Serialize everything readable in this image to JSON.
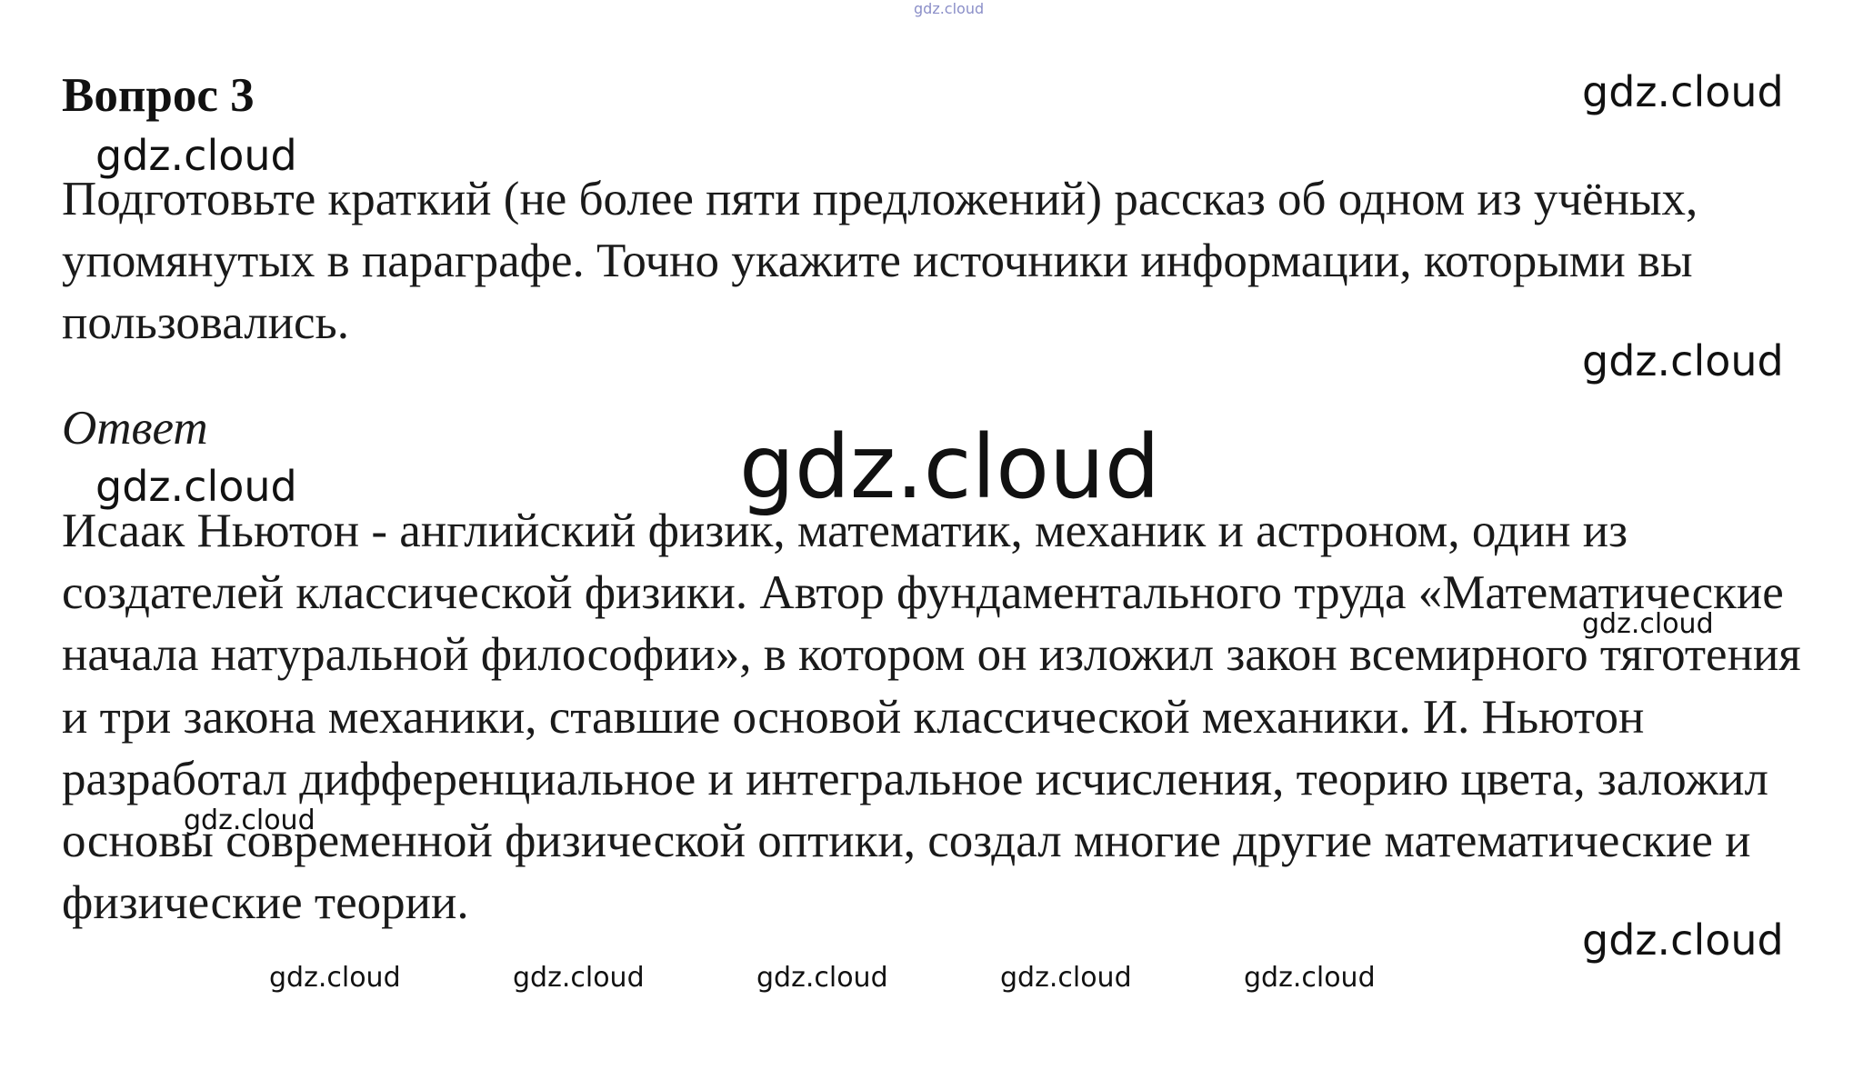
{
  "heading": "Вопрос 3",
  "question": "Подготовьте краткий (не более пяти предложений) рассказ об одном из учёных, упомянутых в параграфе. Точно укажите источники информации, которыми вы пользовались.",
  "answer_label": "Ответ",
  "answer_text": "Исаак Ньютон - английский физик, математик, механик и астроном, один из создателей классической физики. Автор фундаментального труда «Математические начала натуральной философии», в котором он изложил закон всемирного тяготения и три закона механики, ставшие основой классической механики. И. Ньютон разработал дифференциальное и интегральное исчисления, теорию цвета, заложил основы современной физической оптики, создал многие другие математические и физические теории.",
  "watermark": "gdz.cloud"
}
